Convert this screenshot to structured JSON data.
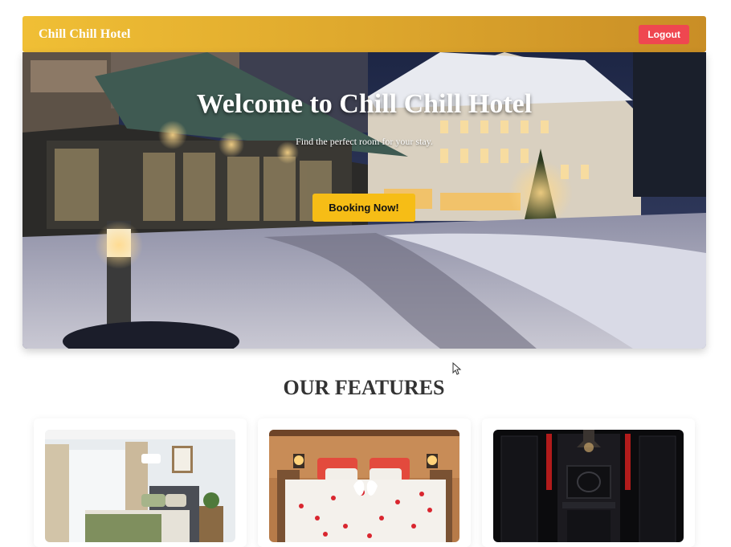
{
  "header": {
    "brand": "Chill Chill Hotel",
    "logout_label": "Logout"
  },
  "hero": {
    "title": "Welcome to Chill Chill Hotel",
    "subtitle": "Find the perfect room for your stay.",
    "cta_label": "Booking Now!"
  },
  "features": {
    "title": "OUR FEATURES"
  },
  "colors": {
    "brand_gold": "#f0bf35",
    "logout_red": "#ef4750",
    "cta_yellow": "#f6bd16",
    "heading_dark": "#333333"
  }
}
